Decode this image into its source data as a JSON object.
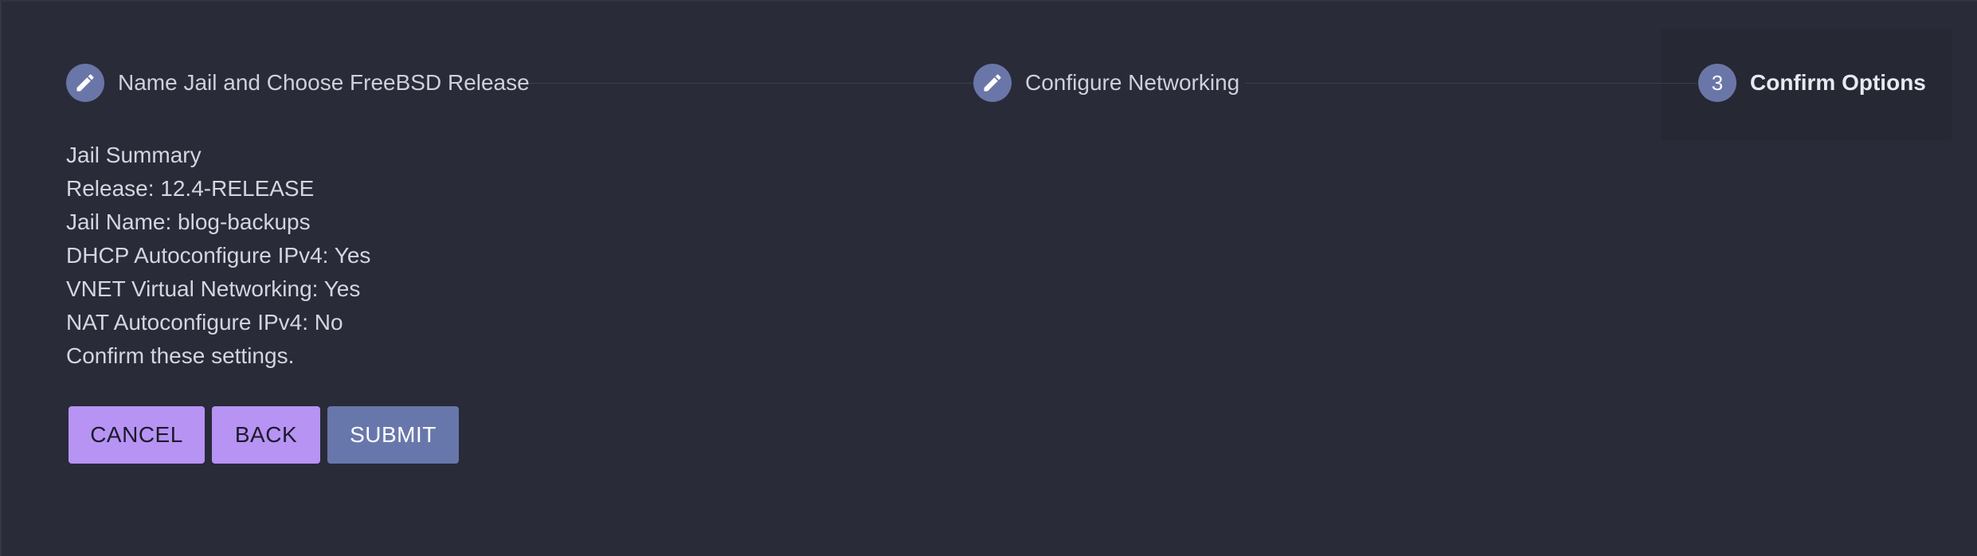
{
  "stepper": {
    "steps": [
      {
        "index": "1",
        "label": "Name Jail and Choose FreeBSD Release",
        "state": "completed",
        "icon": "pencil-icon"
      },
      {
        "index": "2",
        "label": "Configure Networking",
        "state": "completed",
        "icon": "pencil-icon"
      },
      {
        "index": "3",
        "label": "Confirm Options",
        "state": "active",
        "icon": ""
      }
    ]
  },
  "summary": {
    "heading": "Jail Summary",
    "lines": [
      "Release: 12.4-RELEASE",
      "Jail Name: blog-backups",
      "DHCP Autoconfigure IPv4: Yes",
      "VNET Virtual Networking: Yes",
      "NAT Autoconfigure IPv4: No"
    ],
    "confirm_text": "Confirm these settings."
  },
  "actions": {
    "cancel_label": "CANCEL",
    "back_label": "BACK",
    "submit_label": "SUBMIT"
  },
  "colors": {
    "background": "#292b38",
    "step_circle": "#6a76a8",
    "primary_button": "#b793f4",
    "submit_button": "#6877ab"
  }
}
